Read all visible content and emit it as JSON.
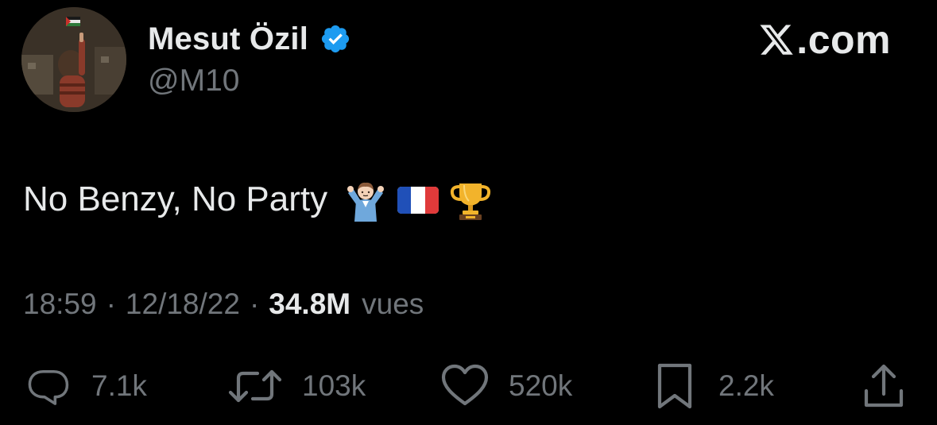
{
  "author": {
    "display_name": "Mesut Özil",
    "handle": "@M10",
    "verified": true,
    "verified_color": "#1d9bf0"
  },
  "brand": {
    "icon": "x-logo-icon",
    "text": ".com"
  },
  "tweet": {
    "text": "No Benzy, No Party",
    "emojis": [
      "person-shrugging-emoji",
      "france-flag-emoji",
      "trophy-emoji"
    ]
  },
  "meta": {
    "time": "18:59",
    "separator": "·",
    "date": "12/18/22",
    "views_count": "34.8M",
    "views_label": "vues"
  },
  "actions": {
    "replies": "7.1k",
    "reposts": "103k",
    "likes": "520k",
    "bookmarks": "2.2k"
  },
  "colors": {
    "background": "#000000",
    "text_primary": "#e7e9ea",
    "text_secondary": "#71767b"
  }
}
